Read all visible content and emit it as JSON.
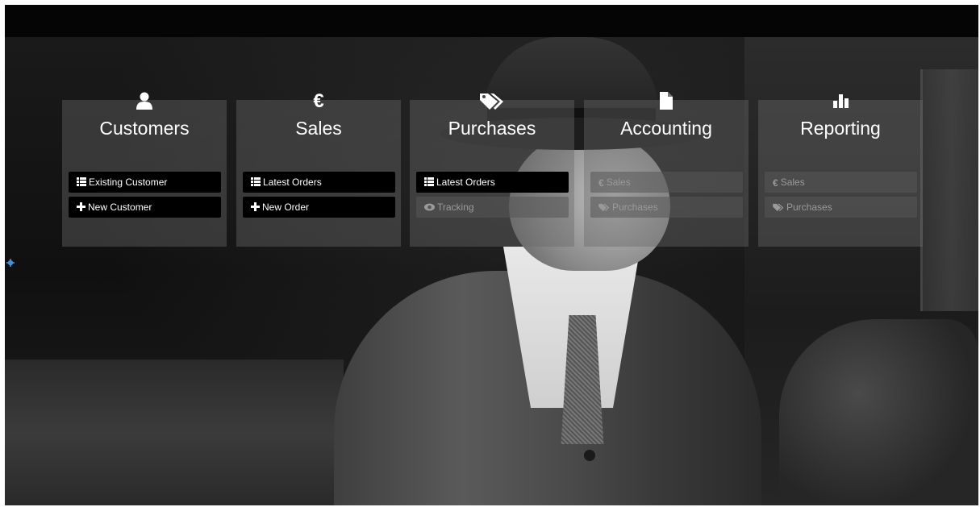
{
  "modules": [
    {
      "title": "Customers",
      "icon": "user-icon",
      "buttons": [
        {
          "label": "Existing Customer",
          "icon": "list-icon",
          "state": "active"
        },
        {
          "label": "New Customer",
          "icon": "plus-icon",
          "state": "active"
        }
      ]
    },
    {
      "title": "Sales",
      "icon": "euro-icon",
      "buttons": [
        {
          "label": "Latest Orders",
          "icon": "list-icon",
          "state": "active"
        },
        {
          "label": "New Order",
          "icon": "plus-icon",
          "state": "active"
        }
      ]
    },
    {
      "title": "Purchases",
      "icon": "tags-icon",
      "buttons": [
        {
          "label": "Latest Orders",
          "icon": "list-icon",
          "state": "active"
        },
        {
          "label": "Tracking",
          "icon": "eye-icon",
          "state": "disabled"
        }
      ]
    },
    {
      "title": "Accounting",
      "icon": "file-icon",
      "buttons": [
        {
          "label": "Sales",
          "icon": "euro-icon",
          "state": "disabled"
        },
        {
          "label": "Purchases",
          "icon": "tags-icon",
          "state": "disabled"
        }
      ]
    },
    {
      "title": "Reporting",
      "icon": "bar-chart-icon",
      "buttons": [
        {
          "label": "Sales",
          "icon": "euro-icon",
          "state": "disabled"
        },
        {
          "label": "Purchases",
          "icon": "tags-icon",
          "state": "disabled"
        }
      ]
    }
  ],
  "colors": {
    "card_bg": "#696969",
    "active_button_bg": "#000000",
    "disabled_button_bg": "#555555",
    "gear_icon": "#4a90d9"
  },
  "settings_icon": "gear-icon"
}
